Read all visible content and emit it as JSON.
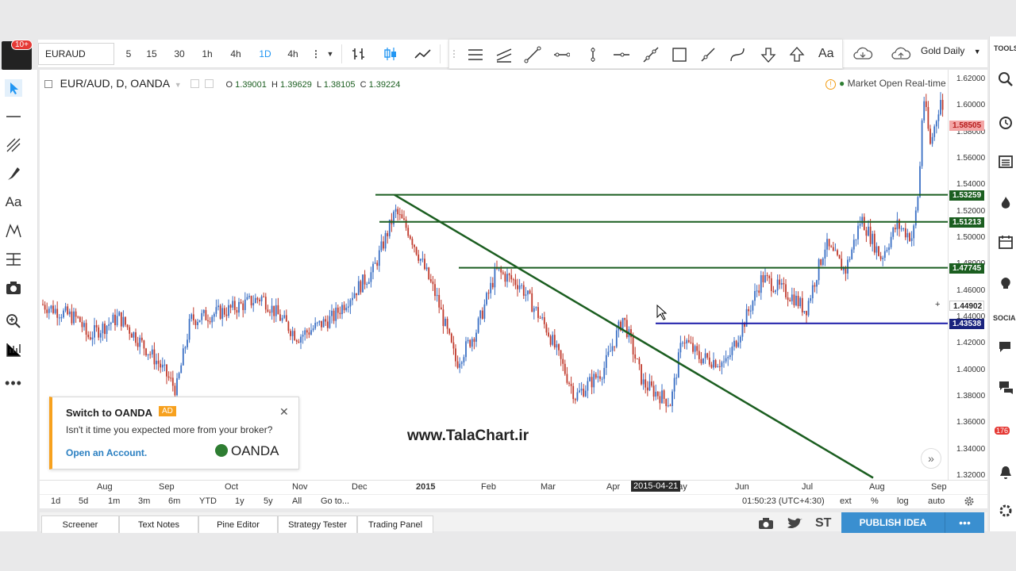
{
  "toolbar": {
    "symbol": "EURAUD",
    "intervals": [
      "5",
      "15",
      "30",
      "1h",
      "4h",
      "1D",
      "4h"
    ],
    "active_interval": "1D",
    "gold_daily": "Gold Daily"
  },
  "float_toolbar": {
    "text_tool": "Aa"
  },
  "user": {
    "notifications": "10+"
  },
  "legend": {
    "symbol": "EUR/AUD, D, OANDA",
    "open_label": "O",
    "open": "1.39001",
    "high_label": "H",
    "high": "1.39629",
    "low_label": "L",
    "low": "1.38105",
    "close_label": "C",
    "close": "1.39224"
  },
  "market_status": "Market Open  Real-time",
  "price_axis": {
    "ticks": [
      "1.62000",
      "1.60000",
      "1.58000",
      "1.56000",
      "1.54000",
      "1.52000",
      "1.50000",
      "1.48000",
      "1.46000",
      "1.44000",
      "1.42000",
      "1.40000",
      "1.38000",
      "1.36000",
      "1.34000",
      "1.32000"
    ],
    "tags": [
      {
        "value": "1.58505",
        "color": "#f3a6a6",
        "text_color": "#c62828"
      },
      {
        "value": "1.53259",
        "color": "#1b5e20"
      },
      {
        "value": "1.51213",
        "color": "#1b5e20"
      },
      {
        "value": "1.47745",
        "color": "#1b5e20"
      },
      {
        "value": "1.44902",
        "color": "#333333",
        "text_color": "#333333"
      },
      {
        "value": "1.43538",
        "color": "#1a237e"
      }
    ]
  },
  "time_axis": {
    "labels": [
      "Aug",
      "Sep",
      "Oct",
      "Nov",
      "Dec",
      "2015",
      "Feb",
      "Mar",
      "Apr",
      "May",
      "Jun",
      "Jul",
      "Aug",
      "Sep"
    ],
    "crosshair_date": "2015-04-21"
  },
  "range_bar": {
    "ranges": [
      "1d",
      "5d",
      "1m",
      "3m",
      "6m",
      "YTD",
      "1y",
      "5y",
      "All"
    ],
    "goto": "Go to...",
    "clock": "01:50:23 (UTC+4:30)",
    "options": [
      "ext",
      "%",
      "log",
      "auto"
    ]
  },
  "bottom_tabs": [
    "Screener",
    "Text Notes",
    "Pine Editor",
    "Strategy Tester",
    "Trading Panel"
  ],
  "publish": "PUBLISH IDEA",
  "social_st": "ST",
  "ad": {
    "title": "Switch to OANDA",
    "badge": "AD",
    "text": "Isn't it time you expected more from your broker?",
    "link": "Open an Account.",
    "logo": "OANDA"
  },
  "watermark": "www.TalaChart.ir",
  "right_panel": {
    "tools": "TOOLS",
    "social": "SOCIAL",
    "count": "176"
  },
  "colors": {
    "support_line": "#1b5e20",
    "blue_line": "#1a1aa8",
    "candle_up": "#3a6fc4",
    "candle_down": "#c0392b",
    "accent": "#2196f3"
  }
}
